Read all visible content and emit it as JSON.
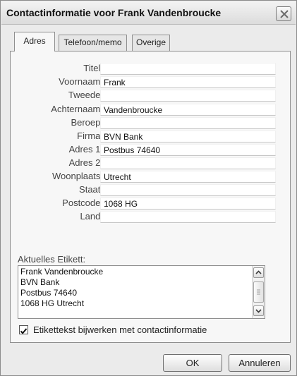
{
  "window": {
    "title": "Contactinformatie voor Frank Vandenbroucke"
  },
  "tabs": [
    {
      "label": "Adres",
      "active": true
    },
    {
      "label": "Telefoon/memo",
      "active": false
    },
    {
      "label": "Overige",
      "active": false
    }
  ],
  "form": {
    "fields": [
      {
        "label": "Titel:",
        "value": ""
      },
      {
        "label": "Voornaam:",
        "value": "Frank"
      },
      {
        "label": "Tweede:",
        "value": ""
      },
      {
        "label": "Achternaam:",
        "value": "Vandenbroucke"
      },
      {
        "label": "Beroep:",
        "value": ""
      },
      {
        "label": "Firma:",
        "value": "BVN Bank"
      },
      {
        "label": "Adres 1:",
        "value": "Postbus 74640"
      },
      {
        "label": "Adres 2:",
        "value": ""
      },
      {
        "label": "Woonplaats:",
        "value": "Utrecht"
      },
      {
        "label": "Staat:",
        "value": ""
      },
      {
        "label": "Postcode:",
        "value": "1068 HG"
      },
      {
        "label": "Land:",
        "value": ""
      }
    ]
  },
  "etiket": {
    "label": "Aktuelles Etikett:",
    "lines": [
      "Frank Vandenbroucke",
      "BVN Bank",
      "Postbus 74640",
      "1068 HG Utrecht"
    ]
  },
  "update_checkbox": {
    "label": "Etikettekst bijwerken met contactinformatie",
    "checked": true
  },
  "buttons": {
    "ok": "OK",
    "cancel": "Annuleren"
  },
  "icons": {
    "close": "close-icon",
    "check": "checkmark-icon",
    "scroll_up": "chevron-up-icon",
    "scroll_down": "chevron-down-icon"
  }
}
